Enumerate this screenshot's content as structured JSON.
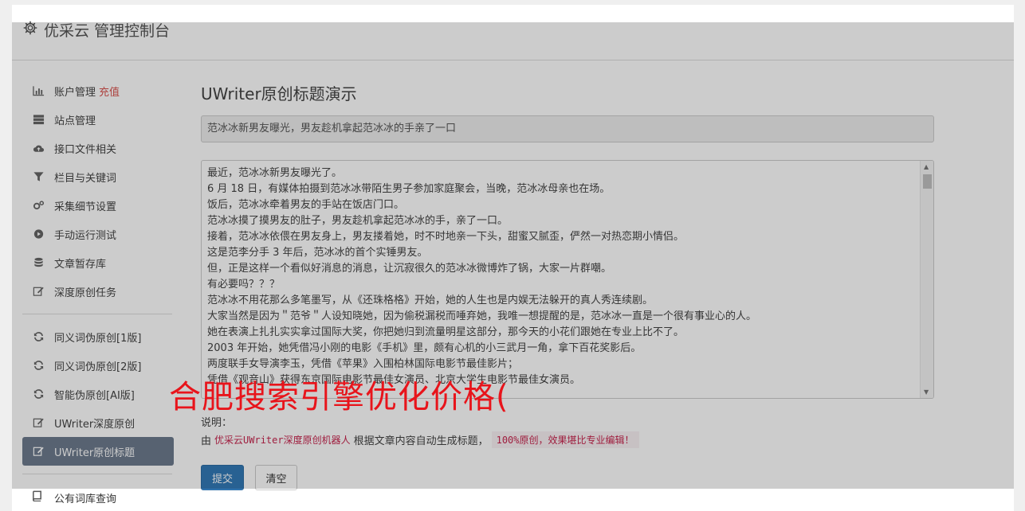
{
  "app": {
    "title": "优采云 管理控制台",
    "icon": "gear-icon"
  },
  "sidebar": {
    "items": [
      {
        "label": "账户管理",
        "extra": "充值",
        "icon": "bar-chart-icon"
      },
      {
        "label": "站点管理",
        "icon": "server-icon"
      },
      {
        "label": "接口文件相关",
        "icon": "cloud-upload-icon"
      },
      {
        "label": "栏目与关键词",
        "icon": "filter-icon"
      },
      {
        "label": "采集细节设置",
        "icon": "gears-icon"
      },
      {
        "label": "手动运行测试",
        "icon": "play-circle-icon"
      },
      {
        "label": "文章暂存库",
        "icon": "database-icon"
      },
      {
        "label": "深度原创任务",
        "icon": "edit-icon"
      }
    ],
    "items2": [
      {
        "label": "同义词伪原创[1版]",
        "icon": "refresh-icon"
      },
      {
        "label": "同义词伪原创[2版]",
        "icon": "refresh-icon"
      },
      {
        "label": "智能伪原创[AI版]",
        "icon": "refresh-icon"
      },
      {
        "label": "UWriter深度原创",
        "icon": "edit-icon"
      },
      {
        "label": "UWriter原创标题",
        "icon": "edit-icon",
        "active": true
      }
    ],
    "items3": [
      {
        "label": "公有词库查询",
        "icon": "book-icon"
      }
    ]
  },
  "main": {
    "title": "UWriter原创标题演示",
    "title_value": "范冰冰新男友曝光，男友趁机拿起范冰冰的手亲了一口",
    "content_lines": [
      "最近，范冰冰新男友曝光了。",
      "6 月 18 日，有媒体拍摄到范冰冰带陌生男子参加家庭聚会，当晚，范冰冰母亲也在场。",
      "饭后，范冰冰牵着男友的手站在饭店门口。",
      "范冰冰摸了摸男友的肚子，男友趁机拿起范冰冰的手，亲了一口。",
      "接着，范冰冰依偎在男友身上，男友搂着她，时不时地亲一下头，甜蜜又腻歪，俨然一对热恋期小情侣。",
      "这是范李分手 3 年后，范冰冰的首个实锤男友。",
      "但，正是这样一个看似好消息的消息，让沉寂很久的范冰冰微博炸了锅，大家一片群嘲。",
      "有必要吗？？？",
      "范冰冰不用花那么多笔墨写，从《还珠格格》开始，她的人生也是内娱无法躲开的真人秀连续剧。",
      "大家当然是因为＂范爷＂人设知晓她，因为偷税漏税而唾弃她，我唯一想提醒的是，范冰冰一直是一个很有事业心的人。",
      "她在表演上扎扎实实拿过国际大奖，你把她归到流量明星这部分，那今天的小花们跟她在专业上比不了。",
      "2003 年开始，她凭借冯小刚的电影《手机》里，颇有心机的小三武月一角，拿下百花奖影后。",
      "两度联手女导演李玉，凭借《苹果》入围柏林国际电影节最佳影片；",
      "凭借《观音山》获得东京国际电影节最佳女演员、北京大学生电影节最佳女演员。"
    ],
    "note_label": "说明：",
    "desc_prefix": "由",
    "desc_link": "优采云UWriter深度原创机器人",
    "desc_middle": "根据文章内容自动生成标题，",
    "desc_code": "100%原创，效果堪比专业编辑！",
    "submit_label": "提交",
    "clear_label": "清空"
  },
  "watermark": "合肥搜索引擎优化价格("
}
